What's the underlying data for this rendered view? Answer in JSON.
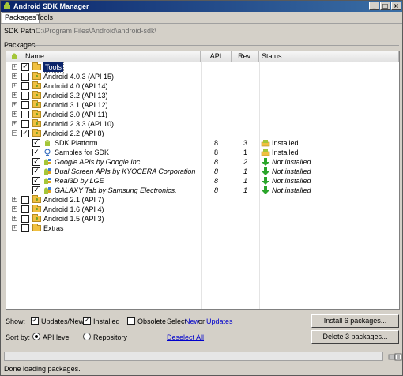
{
  "window": {
    "title": "Android SDK Manager",
    "controls": [
      "minimize",
      "maximize",
      "close"
    ]
  },
  "menu": {
    "items": [
      {
        "label": "Packages",
        "active": true
      },
      {
        "label": "Tools",
        "active": false
      }
    ]
  },
  "sdk_path": {
    "label": "SDK Path:",
    "value": "C:\\Program Files\\Android\\android-sdk\\"
  },
  "packages_group": {
    "label": "Packages"
  },
  "table": {
    "columns": {
      "name": "Name",
      "api": "API",
      "rev": "Rev.",
      "status": "Status"
    },
    "rows": [
      {
        "level": 0,
        "expander": "+",
        "checked": true,
        "icon": "folder-icon",
        "name": "Tools",
        "selected": true,
        "italic": false,
        "api": "",
        "rev": "",
        "status": "",
        "status_icon": ""
      },
      {
        "level": 0,
        "expander": "+",
        "checked": false,
        "icon": "android-folder-icon",
        "name": "Android 4.0.3 (API 15)",
        "italic": false,
        "api": "",
        "rev": "",
        "status": "",
        "status_icon": ""
      },
      {
        "level": 0,
        "expander": "+",
        "checked": false,
        "icon": "android-folder-icon",
        "name": "Android 4.0 (API 14)",
        "italic": false,
        "api": "",
        "rev": "",
        "status": "",
        "status_icon": ""
      },
      {
        "level": 0,
        "expander": "+",
        "checked": false,
        "icon": "android-folder-icon",
        "name": "Android 3.2 (API 13)",
        "italic": false,
        "api": "",
        "rev": "",
        "status": "",
        "status_icon": ""
      },
      {
        "level": 0,
        "expander": "+",
        "checked": false,
        "icon": "android-folder-icon",
        "name": "Android 3.1 (API 12)",
        "italic": false,
        "api": "",
        "rev": "",
        "status": "",
        "status_icon": ""
      },
      {
        "level": 0,
        "expander": "+",
        "checked": false,
        "icon": "android-folder-icon",
        "name": "Android 3.0 (API 11)",
        "italic": false,
        "api": "",
        "rev": "",
        "status": "",
        "status_icon": ""
      },
      {
        "level": 0,
        "expander": "+",
        "checked": false,
        "icon": "android-folder-icon",
        "name": "Android 2.3.3 (API 10)",
        "italic": false,
        "api": "",
        "rev": "",
        "status": "",
        "status_icon": ""
      },
      {
        "level": 0,
        "expander": "−",
        "checked": true,
        "icon": "android-folder-icon",
        "name": "Android 2.2 (API 8)",
        "italic": false,
        "api": "",
        "rev": "",
        "status": "",
        "status_icon": ""
      },
      {
        "level": 1,
        "expander": "",
        "checked": true,
        "icon": "sdk-platform-icon",
        "name": "SDK Platform",
        "italic": false,
        "api": "8",
        "rev": "3",
        "status": "Installed",
        "status_icon": "installed-icon"
      },
      {
        "level": 1,
        "expander": "",
        "checked": true,
        "icon": "samples-icon",
        "name": "Samples for SDK",
        "italic": false,
        "api": "8",
        "rev": "1",
        "status": "Installed",
        "status_icon": "installed-icon"
      },
      {
        "level": 1,
        "expander": "",
        "checked": true,
        "icon": "addon-icon",
        "name": "Google APIs by Google Inc.",
        "italic": true,
        "api": "8",
        "rev": "2",
        "status": "Not installed",
        "status_icon": "download-arrow-icon"
      },
      {
        "level": 1,
        "expander": "",
        "checked": true,
        "icon": "addon-icon",
        "name": "Dual Screen APIs by KYOCERA Corporation",
        "italic": true,
        "api": "8",
        "rev": "1",
        "status": "Not installed",
        "status_icon": "download-arrow-icon"
      },
      {
        "level": 1,
        "expander": "",
        "checked": true,
        "icon": "addon-icon",
        "name": "Real3D by LGE",
        "italic": true,
        "api": "8",
        "rev": "1",
        "status": "Not installed",
        "status_icon": "download-arrow-icon"
      },
      {
        "level": 1,
        "expander": "",
        "checked": true,
        "icon": "addon-icon",
        "name": "GALAXY Tab by Samsung Electronics.",
        "italic": true,
        "api": "8",
        "rev": "1",
        "status": "Not installed",
        "status_icon": "download-arrow-icon"
      },
      {
        "level": 0,
        "expander": "+",
        "checked": false,
        "icon": "android-folder-icon",
        "name": "Android 2.1 (API 7)",
        "italic": false,
        "api": "",
        "rev": "",
        "status": "",
        "status_icon": ""
      },
      {
        "level": 0,
        "expander": "+",
        "checked": false,
        "icon": "android-folder-icon",
        "name": "Android 1.6 (API 4)",
        "italic": false,
        "api": "",
        "rev": "",
        "status": "",
        "status_icon": ""
      },
      {
        "level": 0,
        "expander": "+",
        "checked": false,
        "icon": "android-folder-icon",
        "name": "Android 1.5 (API 3)",
        "italic": false,
        "api": "",
        "rev": "",
        "status": "",
        "status_icon": ""
      },
      {
        "level": 0,
        "expander": "+",
        "checked": false,
        "icon": "folder-icon",
        "name": "Extras",
        "italic": false,
        "api": "",
        "rev": "",
        "status": "",
        "status_icon": ""
      }
    ]
  },
  "show": {
    "label": "Show:",
    "updates_new": {
      "label": "Updates/New",
      "checked": true
    },
    "installed": {
      "label": "Installed",
      "checked": true
    },
    "obsolete": {
      "label": "Obsolete",
      "checked": false
    },
    "select_prefix": "Select",
    "new_link": "New",
    "or_text": "or",
    "updates_link": "Updates"
  },
  "sort": {
    "label": "Sort by:",
    "api_level": {
      "label": "API level",
      "selected": true
    },
    "repository": {
      "label": "Repository",
      "selected": false
    },
    "deselect_link": "Deselect All"
  },
  "buttons": {
    "install": "Install 6 packages...",
    "delete": "Delete 3 packages..."
  },
  "status_bar": {
    "text": "Done loading packages."
  },
  "colors": {
    "title_start": "#0a246a",
    "title_end": "#3a6ea5",
    "selected_row": "#0a246a",
    "link": "#0000cc",
    "installed_green": "#2aa52a"
  }
}
